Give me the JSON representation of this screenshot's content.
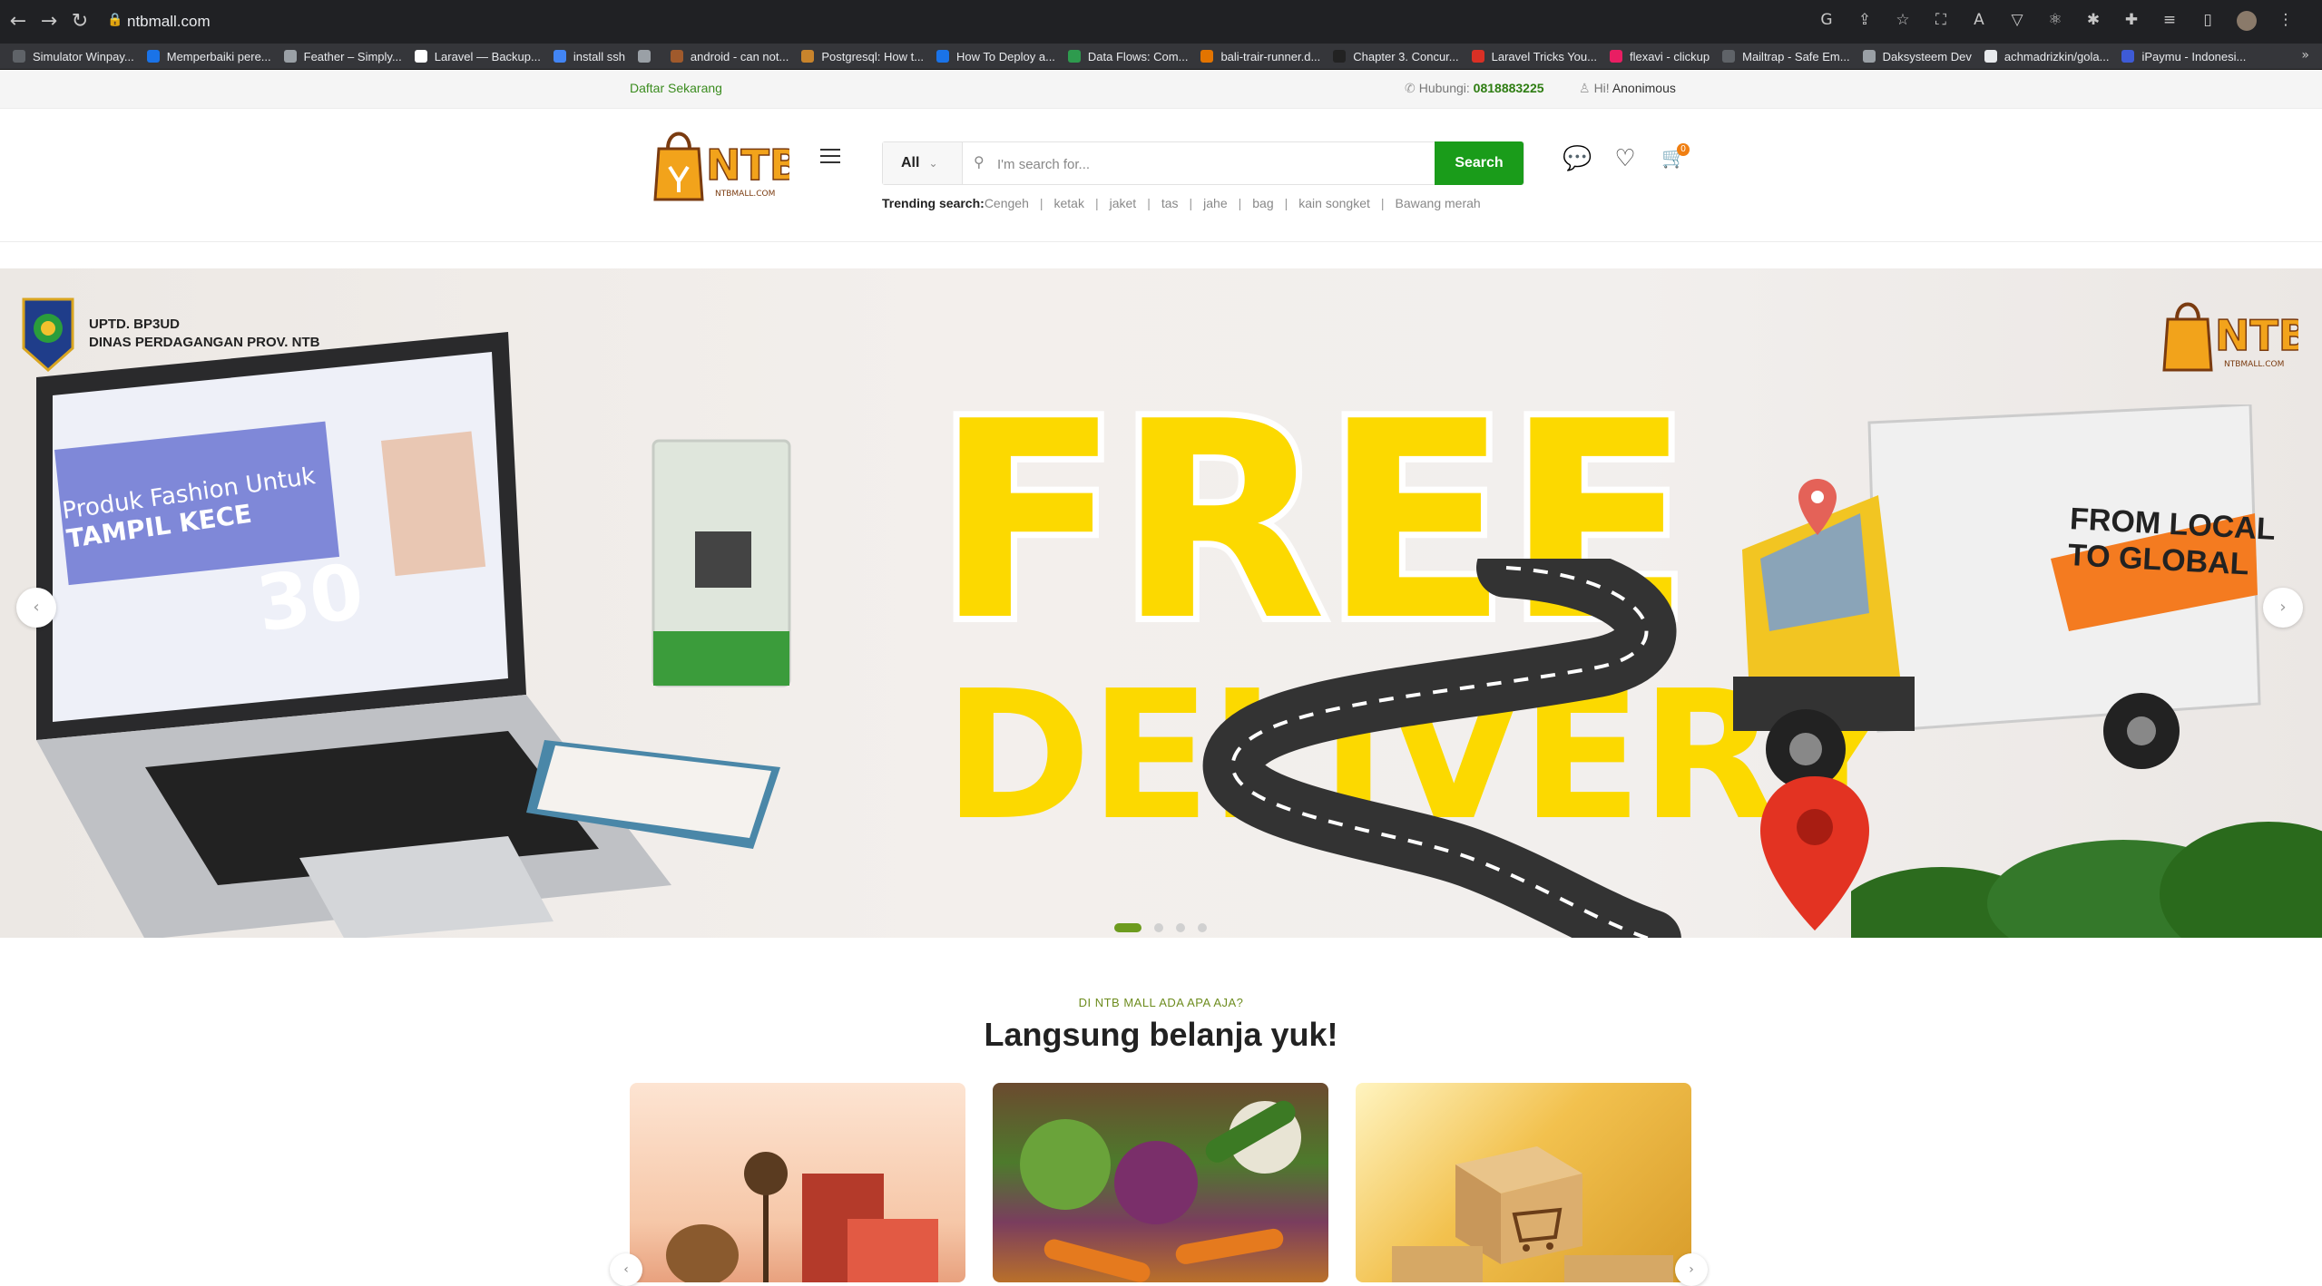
{
  "browser": {
    "url": "ntbmall.com",
    "bookmarks": [
      "Simulator Winpay...",
      "Memperbaiki pere...",
      "Feather – Simply...",
      "Laravel — Backup...",
      "install ssh",
      "",
      "android - can not...",
      "Postgresql: How t...",
      "How To Deploy a...",
      "Data Flows: Com...",
      "bali-trair-runner.d...",
      "Chapter 3. Concur...",
      "Laravel Tricks You...",
      "flexavi - clickup",
      "Mailtrap - Safe Em...",
      "Daksysteem Dev",
      "achmadrizkin/gola...",
      "iPaymu - Indonesi..."
    ]
  },
  "topbar": {
    "register": "Daftar Sekarang",
    "contact_label": "Hubungi:",
    "contact_phone": "0818883225",
    "greeting": "Hi!",
    "username": "Anonimous"
  },
  "header": {
    "category": "All",
    "search_placeholder": "I'm search for...",
    "search_button": "Search",
    "trending_label": "Trending search:",
    "trending": [
      "Cengeh",
      "ketak",
      "jaket",
      "tas",
      "jahe",
      "bag",
      "kain songket",
      "Bawang merah"
    ],
    "cart_count": "0"
  },
  "banner": {
    "agency_line1": "UPTD. BP3UD",
    "agency_line2": "DINAS PERDAGANGAN PROV. NTB",
    "headline1": "FREE",
    "headline2": "DELIVERY",
    "truck_text1": "FROM LOCAL",
    "truck_text2": "TO GLOBAL",
    "laptop_text1": "Produk Fashion Untuk",
    "laptop_text2": "TAMPIL KECE",
    "slide_count": 4,
    "active_slide": 1
  },
  "section": {
    "kicker": "DI NTB MALL ADA APA AJA?",
    "title": "Langsung belanja yuk!"
  },
  "colors": {
    "brand_green": "#1a9c1a",
    "accent_orange": "#f07f12",
    "headline_yellow": "#fcd900"
  }
}
